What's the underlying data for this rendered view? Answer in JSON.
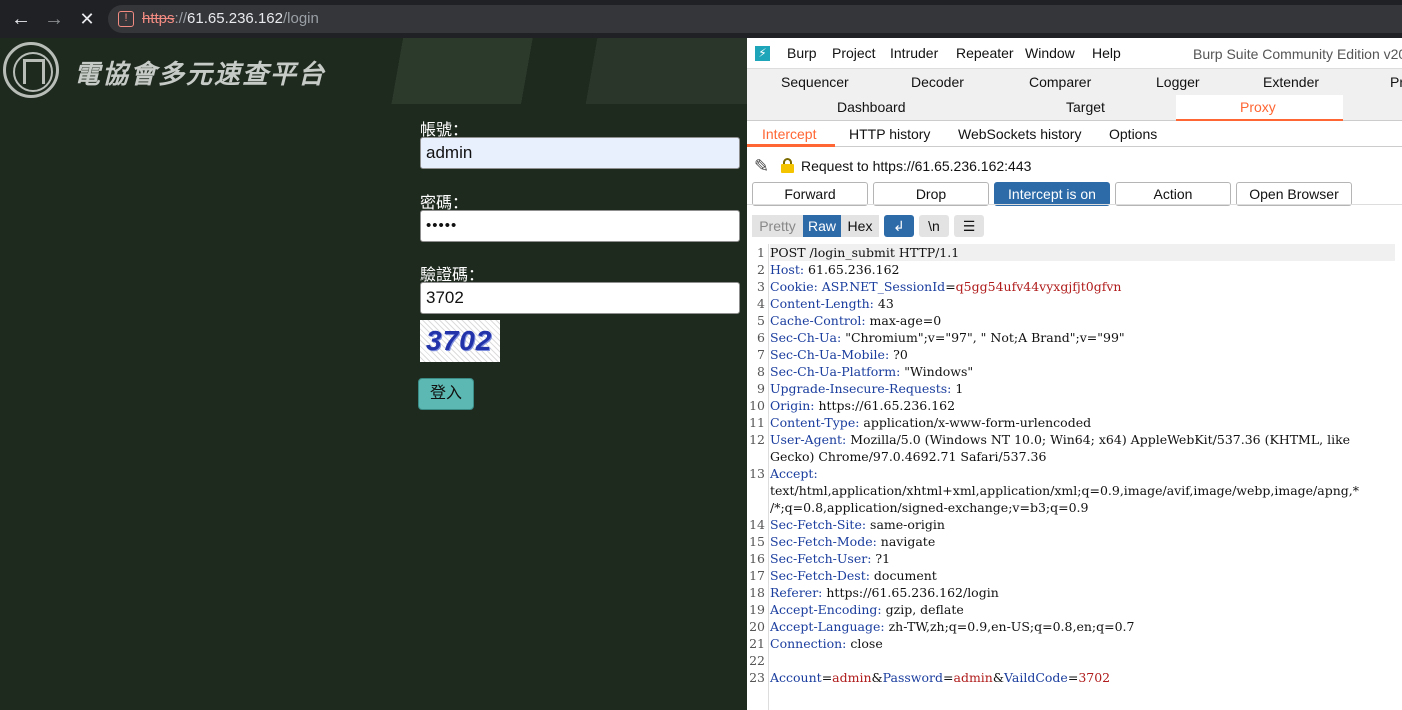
{
  "browser": {
    "url_scheme": "https",
    "url_sep": "://",
    "url_host": "61.65.236.162",
    "url_path": "/login"
  },
  "webpage": {
    "site_title": "電協會多元速查平台",
    "username_label": "帳號：",
    "username_value": "admin",
    "password_label": "密碼：",
    "password_value": "•••••",
    "captcha_label": "驗證碼：",
    "captcha_input_value": "3702",
    "captcha_image_text": "3702",
    "login_button": "登入"
  },
  "burp": {
    "menu": [
      "Burp",
      "Project",
      "Intruder",
      "Repeater",
      "Window",
      "Help"
    ],
    "title": "Burp Suite Community Edition v20",
    "tabs_row1": [
      "Sequencer",
      "Decoder",
      "Comparer",
      "Logger",
      "Extender",
      "Pr"
    ],
    "tabs_row2": [
      "Dashboard",
      "Target",
      "Proxy"
    ],
    "proxy_subtabs": [
      "Intercept",
      "HTTP history",
      "WebSockets history",
      "Options"
    ],
    "request_target": "Request to https://61.65.236.162:443",
    "buttons": {
      "forward": "Forward",
      "drop": "Drop",
      "intercept": "Intercept is on",
      "action": "Action",
      "open_browser": "Open Browser"
    },
    "view_modes": [
      "Pretty",
      "Raw",
      "Hex"
    ],
    "tool_icons": [
      "wrap-lines-icon",
      "newline-icon",
      "menu-icon"
    ],
    "newline_label": "\\n",
    "line_numbers": [
      "1",
      "2",
      "3",
      "4",
      "5",
      "6",
      "7",
      "8",
      "9",
      "10",
      "11",
      "12",
      "",
      "13",
      "",
      "",
      "14",
      "15",
      "16",
      "17",
      "18",
      "19",
      "20",
      "21",
      "22",
      "23"
    ],
    "request_lines": [
      {
        "name": "",
        "value": "POST /login_submit HTTP/1.1"
      },
      {
        "name": "Host:",
        "value": " 61.65.236.162"
      },
      {
        "name": "Cookie:",
        "value": " ASP.NET_SessionId=q5gg54ufv44vyxgjfjt0gfvn",
        "value_is_cookie": true
      },
      {
        "name": "Content-Length:",
        "value": " 43"
      },
      {
        "name": "Cache-Control:",
        "value": " max-age=0"
      },
      {
        "name": "Sec-Ch-Ua:",
        "value": " \"Chromium\";v=\"97\", \" Not;A Brand\";v=\"99\""
      },
      {
        "name": "Sec-Ch-Ua-Mobile:",
        "value": " ?0"
      },
      {
        "name": "Sec-Ch-Ua-Platform:",
        "value": " \"Windows\""
      },
      {
        "name": "Upgrade-Insecure-Requests:",
        "value": " 1"
      },
      {
        "name": "Origin:",
        "value": " https://61.65.236.162"
      },
      {
        "name": "Content-Type:",
        "value": " application/x-www-form-urlencoded"
      },
      {
        "name": "User-Agent:",
        "value": " Mozilla/5.0 (Windows NT 10.0; Win64; x64) AppleWebKit/537.36 (KHTML, like"
      },
      {
        "name": "",
        "value": "Gecko) Chrome/97.0.4692.71 Safari/537.36"
      },
      {
        "name": "Accept:",
        "value": ""
      },
      {
        "name": "",
        "value": "text/html,application/xhtml+xml,application/xml;q=0.9,image/avif,image/webp,image/apng,*"
      },
      {
        "name": "",
        "value": "/*;q=0.8,application/signed-exchange;v=b3;q=0.9"
      },
      {
        "name": "Sec-Fetch-Site:",
        "value": " same-origin"
      },
      {
        "name": "Sec-Fetch-Mode:",
        "value": " navigate"
      },
      {
        "name": "Sec-Fetch-User:",
        "value": " ?1"
      },
      {
        "name": "Sec-Fetch-Dest:",
        "value": " document"
      },
      {
        "name": "Referer:",
        "value": " https://61.65.236.162/login"
      },
      {
        "name": "Accept-Encoding:",
        "value": " gzip, deflate"
      },
      {
        "name": "Accept-Language:",
        "value": " zh-TW,zh;q=0.9,en-US;q=0.8,en;q=0.7"
      },
      {
        "name": "Connection:",
        "value": " close"
      },
      {
        "name": "",
        "value": ""
      },
      {
        "name": "",
        "value": "",
        "body": true
      }
    ],
    "body_params": [
      {
        "key": "Account",
        "value": "admin"
      },
      {
        "key": "Password",
        "value": "admin"
      },
      {
        "key": "VaildCode",
        "value": "3702"
      }
    ]
  },
  "colors": {
    "page_bg": "#1f2a1f",
    "burp_accent": "#ff6633",
    "burp_blue": "#2c6aa8",
    "header_name": "#1a3d9e",
    "cookie_value": "#b01b1b"
  }
}
